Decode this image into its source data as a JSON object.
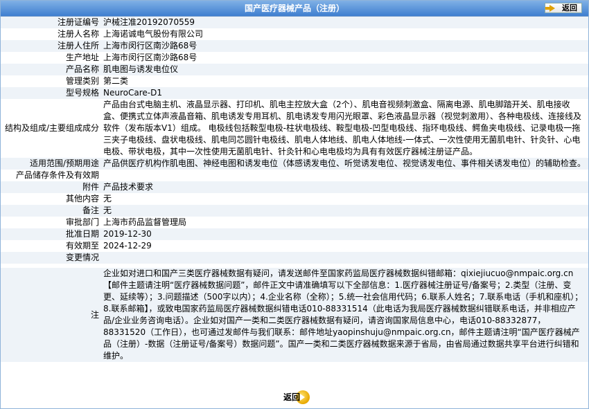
{
  "header": {
    "title": "国产医疗器械产品（注册）",
    "back_label": "返回"
  },
  "rows": [
    {
      "label": "注册证编号",
      "value": "沪械注准20192070559"
    },
    {
      "label": "注册人名称",
      "value": "上海诺诚电气股份有限公司"
    },
    {
      "label": "注册人住所",
      "value": "上海市闵行区南沙路68号"
    },
    {
      "label": "生产地址",
      "value": "上海市闵行区南沙路68号"
    },
    {
      "label": "产品名称",
      "value": "肌电图与诱发电位仪"
    },
    {
      "label": "管理类别",
      "value": "第二类"
    },
    {
      "label": "型号规格",
      "value": "NeuroCare-D1"
    },
    {
      "label": "结构及组成/主要组成成分",
      "value": "产品由台式电脑主机、液晶显示器、打印机、肌电主控放大盒（2个）、肌电音视频刺激盒、隔离电源、肌电脚踏开关、肌电接收盒、便携式立体声液晶音箱、肌电诱发专用耳机、肌电诱发专用闪光眼罩、彩色液晶显示器（视觉刺激用）、各种电极线、连接线及软件（发布版本V1）组成。 电极线包括鞍型电极-柱状电极线、鞍型电极-凹型电极线、指环电极线、鳄鱼夹电极线、记录电极一拖三夹子电极线、盘状电极线、肌电同芯圆针电极线、肌电人体地线、肌电人体地线-一体式、一次性使用无菌肌电针、针灸针、心电电极、带状电极，其中一次性使用无菌肌电针、针灸针和心电电极均为具有有效医疗器械注册证产品。"
    },
    {
      "label": "适用范围/预期用途",
      "value": "产品供医疗机构作肌电图、神经电图和诱发电位（体感诱发电位、听觉诱发电位、视觉诱发电位、事件相关诱发电位）的辅助检查。"
    },
    {
      "label": "产品储存条件及有效期",
      "value": ""
    },
    {
      "label": "附件",
      "value": "产品技术要求"
    },
    {
      "label": "其他内容",
      "value": "无"
    },
    {
      "label": "备注",
      "value": "无"
    },
    {
      "label": "审批部门",
      "value": "上海市药品监督管理局"
    },
    {
      "label": "批准日期",
      "value": "2019-12-30"
    },
    {
      "label": "有效期至",
      "value": "2024-12-29"
    },
    {
      "label": "变更情况",
      "value": ""
    },
    {
      "label": "注",
      "value": "企业如对进口和国产三类医疗器械数据有疑问，请发送邮件至国家药监局医疗器械数据纠错邮箱：qixiejiucuo@nmpaic.org.cn【邮件主题请注明“医疗器械数据问题”，邮件正文中请准确填写以下全部信息：1.医疗器械注册证号/备案号；2.类型（注册、变更、延续等）；3.问题描述（500字以内）；4.企业名称（全称）；5.统一社会信用代码；6.联系人姓名；7.联系电话（手机和座机）；8.联系邮箱】，或致电国家药监局医疗器械数据纠错电话010-88331514（此电话为我局医疗器械数据纠错联系电话，并非相应产品/企业业务咨询电话）。企业如对国产一类和二类医疗器械数据有疑问，请咨询国家局信息中心，电话010-88332877，88331520（工作日），也可通过发邮件与我们联系：邮件地址yaopinshuju@nmpaic.org.cn，邮件主题请注明“国产医疗器械产品（注册）-数据（注册证号/备案号）数据问题”。国产一类和二类医疗器械数据来源于省局，由省局通过数据共享平台进行纠错和维护。"
    }
  ],
  "footer": {
    "back_label": "返回"
  }
}
